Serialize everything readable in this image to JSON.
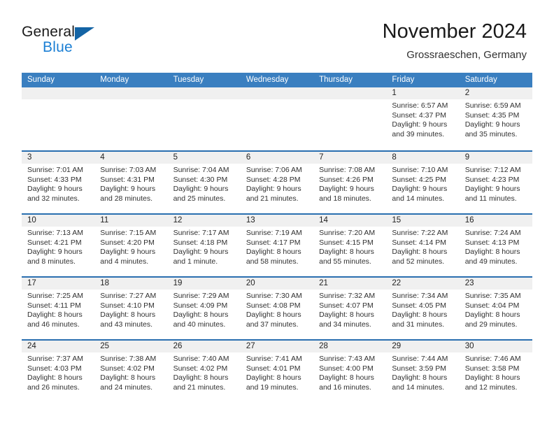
{
  "brand": {
    "name_part1": "General",
    "name_part2": "Blue",
    "logo_icon": "triangle-logo-icon"
  },
  "header": {
    "month_title": "November 2024",
    "location": "Grossraeschen, Germany"
  },
  "calendar": {
    "weekdays": [
      "Sunday",
      "Monday",
      "Tuesday",
      "Wednesday",
      "Thursday",
      "Friday",
      "Saturday"
    ],
    "accent_color": "#3a7fc0",
    "row_border_color": "#2a6fb0",
    "day_band_color": "#f0f0f0",
    "weeks": [
      [
        {
          "day": "",
          "sunrise": "",
          "sunset": "",
          "daylight_line1": "",
          "daylight_line2": ""
        },
        {
          "day": "",
          "sunrise": "",
          "sunset": "",
          "daylight_line1": "",
          "daylight_line2": ""
        },
        {
          "day": "",
          "sunrise": "",
          "sunset": "",
          "daylight_line1": "",
          "daylight_line2": ""
        },
        {
          "day": "",
          "sunrise": "",
          "sunset": "",
          "daylight_line1": "",
          "daylight_line2": ""
        },
        {
          "day": "",
          "sunrise": "",
          "sunset": "",
          "daylight_line1": "",
          "daylight_line2": ""
        },
        {
          "day": "1",
          "sunrise": "Sunrise: 6:57 AM",
          "sunset": "Sunset: 4:37 PM",
          "daylight_line1": "Daylight: 9 hours",
          "daylight_line2": "and 39 minutes."
        },
        {
          "day": "2",
          "sunrise": "Sunrise: 6:59 AM",
          "sunset": "Sunset: 4:35 PM",
          "daylight_line1": "Daylight: 9 hours",
          "daylight_line2": "and 35 minutes."
        }
      ],
      [
        {
          "day": "3",
          "sunrise": "Sunrise: 7:01 AM",
          "sunset": "Sunset: 4:33 PM",
          "daylight_line1": "Daylight: 9 hours",
          "daylight_line2": "and 32 minutes."
        },
        {
          "day": "4",
          "sunrise": "Sunrise: 7:03 AM",
          "sunset": "Sunset: 4:31 PM",
          "daylight_line1": "Daylight: 9 hours",
          "daylight_line2": "and 28 minutes."
        },
        {
          "day": "5",
          "sunrise": "Sunrise: 7:04 AM",
          "sunset": "Sunset: 4:30 PM",
          "daylight_line1": "Daylight: 9 hours",
          "daylight_line2": "and 25 minutes."
        },
        {
          "day": "6",
          "sunrise": "Sunrise: 7:06 AM",
          "sunset": "Sunset: 4:28 PM",
          "daylight_line1": "Daylight: 9 hours",
          "daylight_line2": "and 21 minutes."
        },
        {
          "day": "7",
          "sunrise": "Sunrise: 7:08 AM",
          "sunset": "Sunset: 4:26 PM",
          "daylight_line1": "Daylight: 9 hours",
          "daylight_line2": "and 18 minutes."
        },
        {
          "day": "8",
          "sunrise": "Sunrise: 7:10 AM",
          "sunset": "Sunset: 4:25 PM",
          "daylight_line1": "Daylight: 9 hours",
          "daylight_line2": "and 14 minutes."
        },
        {
          "day": "9",
          "sunrise": "Sunrise: 7:12 AM",
          "sunset": "Sunset: 4:23 PM",
          "daylight_line1": "Daylight: 9 hours",
          "daylight_line2": "and 11 minutes."
        }
      ],
      [
        {
          "day": "10",
          "sunrise": "Sunrise: 7:13 AM",
          "sunset": "Sunset: 4:21 PM",
          "daylight_line1": "Daylight: 9 hours",
          "daylight_line2": "and 8 minutes."
        },
        {
          "day": "11",
          "sunrise": "Sunrise: 7:15 AM",
          "sunset": "Sunset: 4:20 PM",
          "daylight_line1": "Daylight: 9 hours",
          "daylight_line2": "and 4 minutes."
        },
        {
          "day": "12",
          "sunrise": "Sunrise: 7:17 AM",
          "sunset": "Sunset: 4:18 PM",
          "daylight_line1": "Daylight: 9 hours",
          "daylight_line2": "and 1 minute."
        },
        {
          "day": "13",
          "sunrise": "Sunrise: 7:19 AM",
          "sunset": "Sunset: 4:17 PM",
          "daylight_line1": "Daylight: 8 hours",
          "daylight_line2": "and 58 minutes."
        },
        {
          "day": "14",
          "sunrise": "Sunrise: 7:20 AM",
          "sunset": "Sunset: 4:15 PM",
          "daylight_line1": "Daylight: 8 hours",
          "daylight_line2": "and 55 minutes."
        },
        {
          "day": "15",
          "sunrise": "Sunrise: 7:22 AM",
          "sunset": "Sunset: 4:14 PM",
          "daylight_line1": "Daylight: 8 hours",
          "daylight_line2": "and 52 minutes."
        },
        {
          "day": "16",
          "sunrise": "Sunrise: 7:24 AM",
          "sunset": "Sunset: 4:13 PM",
          "daylight_line1": "Daylight: 8 hours",
          "daylight_line2": "and 49 minutes."
        }
      ],
      [
        {
          "day": "17",
          "sunrise": "Sunrise: 7:25 AM",
          "sunset": "Sunset: 4:11 PM",
          "daylight_line1": "Daylight: 8 hours",
          "daylight_line2": "and 46 minutes."
        },
        {
          "day": "18",
          "sunrise": "Sunrise: 7:27 AM",
          "sunset": "Sunset: 4:10 PM",
          "daylight_line1": "Daylight: 8 hours",
          "daylight_line2": "and 43 minutes."
        },
        {
          "day": "19",
          "sunrise": "Sunrise: 7:29 AM",
          "sunset": "Sunset: 4:09 PM",
          "daylight_line1": "Daylight: 8 hours",
          "daylight_line2": "and 40 minutes."
        },
        {
          "day": "20",
          "sunrise": "Sunrise: 7:30 AM",
          "sunset": "Sunset: 4:08 PM",
          "daylight_line1": "Daylight: 8 hours",
          "daylight_line2": "and 37 minutes."
        },
        {
          "day": "21",
          "sunrise": "Sunrise: 7:32 AM",
          "sunset": "Sunset: 4:07 PM",
          "daylight_line1": "Daylight: 8 hours",
          "daylight_line2": "and 34 minutes."
        },
        {
          "day": "22",
          "sunrise": "Sunrise: 7:34 AM",
          "sunset": "Sunset: 4:05 PM",
          "daylight_line1": "Daylight: 8 hours",
          "daylight_line2": "and 31 minutes."
        },
        {
          "day": "23",
          "sunrise": "Sunrise: 7:35 AM",
          "sunset": "Sunset: 4:04 PM",
          "daylight_line1": "Daylight: 8 hours",
          "daylight_line2": "and 29 minutes."
        }
      ],
      [
        {
          "day": "24",
          "sunrise": "Sunrise: 7:37 AM",
          "sunset": "Sunset: 4:03 PM",
          "daylight_line1": "Daylight: 8 hours",
          "daylight_line2": "and 26 minutes."
        },
        {
          "day": "25",
          "sunrise": "Sunrise: 7:38 AM",
          "sunset": "Sunset: 4:02 PM",
          "daylight_line1": "Daylight: 8 hours",
          "daylight_line2": "and 24 minutes."
        },
        {
          "day": "26",
          "sunrise": "Sunrise: 7:40 AM",
          "sunset": "Sunset: 4:02 PM",
          "daylight_line1": "Daylight: 8 hours",
          "daylight_line2": "and 21 minutes."
        },
        {
          "day": "27",
          "sunrise": "Sunrise: 7:41 AM",
          "sunset": "Sunset: 4:01 PM",
          "daylight_line1": "Daylight: 8 hours",
          "daylight_line2": "and 19 minutes."
        },
        {
          "day": "28",
          "sunrise": "Sunrise: 7:43 AM",
          "sunset": "Sunset: 4:00 PM",
          "daylight_line1": "Daylight: 8 hours",
          "daylight_line2": "and 16 minutes."
        },
        {
          "day": "29",
          "sunrise": "Sunrise: 7:44 AM",
          "sunset": "Sunset: 3:59 PM",
          "daylight_line1": "Daylight: 8 hours",
          "daylight_line2": "and 14 minutes."
        },
        {
          "day": "30",
          "sunrise": "Sunrise: 7:46 AM",
          "sunset": "Sunset: 3:58 PM",
          "daylight_line1": "Daylight: 8 hours",
          "daylight_line2": "and 12 minutes."
        }
      ]
    ]
  }
}
